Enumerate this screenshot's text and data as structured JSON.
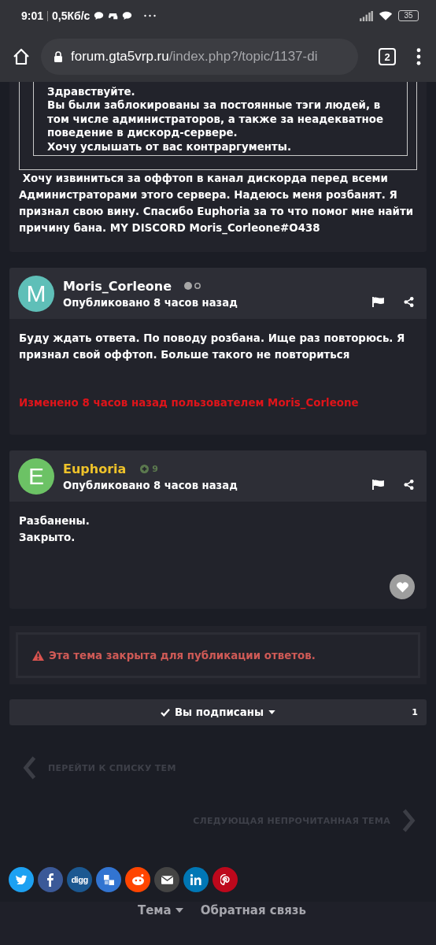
{
  "status_bar": {
    "time": "9:01",
    "speed": "0,5Кб/с",
    "battery": "35"
  },
  "browser": {
    "url_host": "forum.gta5vrp.ru",
    "url_path": "/index.php?/topic/1137-di",
    "tab_count": "2"
  },
  "quoted_post": {
    "quote_lines": [
      "Здравствуйте.",
      "Вы были заблокированы за постоянные тэги людей, в том числе администраторов, а также за неадекватное поведение в дискорд-сервере.",
      "Хочу услышать от вас контраргументы."
    ],
    "text": " Хочу извиниться за оффтоп в канал дискорда перед всеми Администраторами этого сервера. Надеюсь меня розбанят. Я признал свою вину. Спасибо Euphoria за то что помог мне найти причину бана. MY DISCORD Moris_Corleone#O438"
  },
  "posts": [
    {
      "author": {
        "name": "Moris_Corleone",
        "color": "#ffffff"
      },
      "avatar": {
        "letter": "M",
        "color": "#5fbfb8"
      },
      "badge": {
        "kind": "dots"
      },
      "date": "Опубликовано 8 часов назад",
      "paragraphs": [
        "Буду ждать ответа. По поводу розбана. Ище раз повторюсь. Я признал свой оффтоп. Больше такого не повториться"
      ],
      "edited_note": "Изменено 8 часов назад пользователем Moris_Corleone",
      "like_button": false
    },
    {
      "author": {
        "name": "Euphoria",
        "color": "#eec22a"
      },
      "avatar": {
        "letter": "E",
        "color": "#6cc265"
      },
      "badge": {
        "kind": "reputation",
        "count": "9"
      },
      "date": "Опубликовано 8 часов назад",
      "paragraphs": [
        "Разбанены.",
        "Закрыто."
      ],
      "like_button": true
    }
  ],
  "closed_notice": "Эта тема закрыта для публикации ответов.",
  "subscribe": {
    "label": "Вы подписаны",
    "count": "1"
  },
  "nav": {
    "previous": "ПЕРЕЙТИ К СПИСКУ ТЕМ",
    "next": "СЛЕДУЮЩАЯ НЕПРОЧИТАННАЯ ТЕМА"
  },
  "share_buttons": [
    {
      "kind": "twitter",
      "color": "#1da1f2"
    },
    {
      "kind": "facebook",
      "color": "#3b5998"
    },
    {
      "kind": "digg",
      "color": "#1b5891",
      "label": "digg"
    },
    {
      "kind": "delicious",
      "color": "#3274d1"
    },
    {
      "kind": "reddit",
      "color": "#ff4500"
    },
    {
      "kind": "email",
      "color": "#444444"
    },
    {
      "kind": "linkedin",
      "color": "#0077b5"
    },
    {
      "kind": "pinterest",
      "color": "#bd081c"
    }
  ],
  "footer": {
    "links": [
      "Тема",
      "Обратная связь"
    ]
  }
}
